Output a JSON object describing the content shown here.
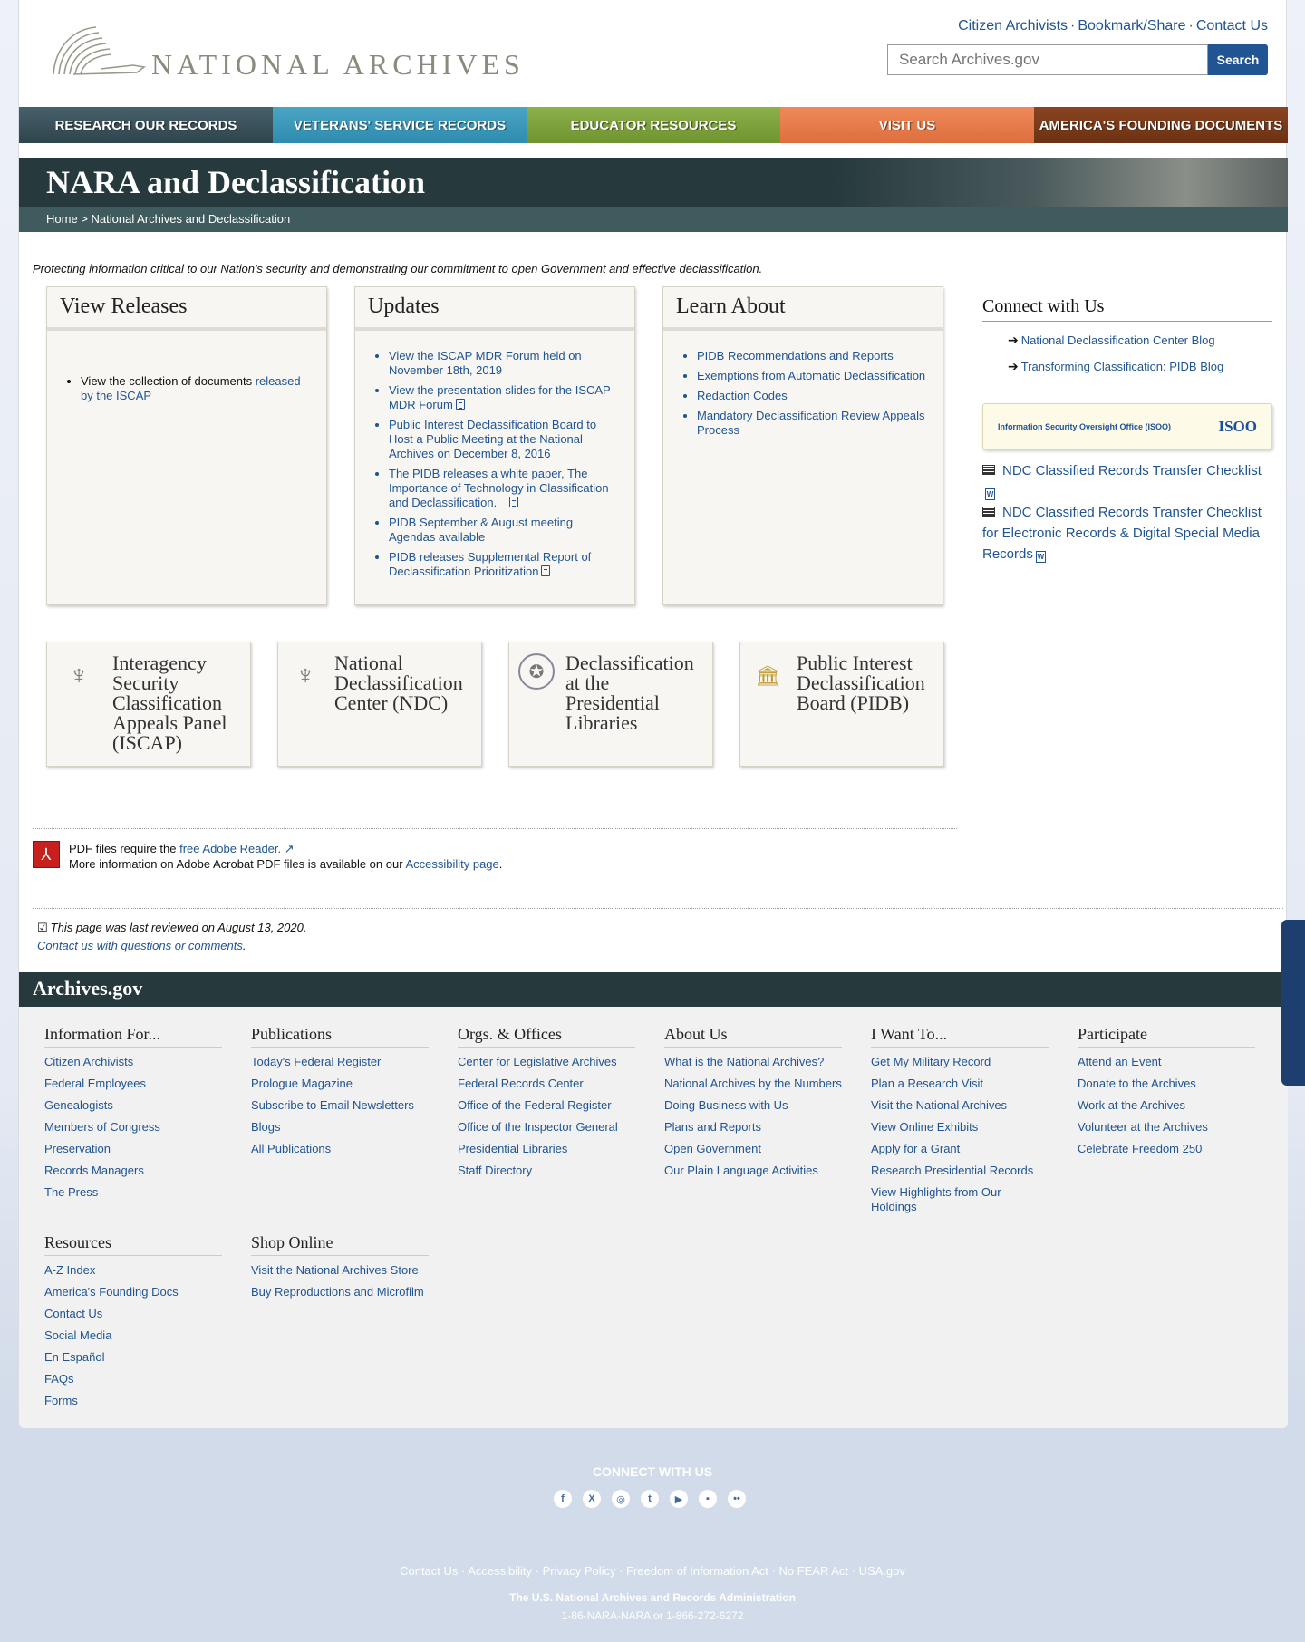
{
  "header": {
    "logo_text": "NATIONAL ARCHIVES",
    "utility_links": [
      "Citizen Archivists",
      "Bookmark/Share",
      "Contact Us"
    ],
    "search": {
      "placeholder": "Search Archives.gov",
      "button": "Search"
    }
  },
  "nav": [
    "RESEARCH OUR RECORDS",
    "VETERANS' SERVICE RECORDS",
    "EDUCATOR RESOURCES",
    "VISIT US",
    "AMERICA'S FOUNDING DOCUMENTS"
  ],
  "banner": {
    "title": "NARA and Declassification",
    "breadcrumb": {
      "home": "Home",
      "separator": ">",
      "current": "National Archives and Declassification"
    }
  },
  "tagline": "Protecting information critical to our Nation's security and demonstrating our commitment to open Government and effective declassification.",
  "view_releases": {
    "title": "View Releases",
    "text": "View the collection of documents ",
    "link": "released by the ISCAP"
  },
  "updates": {
    "title": "Updates",
    "items": [
      "View the ISCAP MDR Forum held on November 18th, 2019",
      "View the presentation slides for the ISCAP MDR Forum",
      "Public Interest Declassification Board to Host a Public Meeting at the National Archives on December 8, 2016",
      "The PIDB releases a white paper, The Importance of Technology in Classification and Declassification.",
      "PIDB September & August meeting Agendas available",
      "PIDB releases Supplemental Report of Declassification Prioritization"
    ]
  },
  "learn_about": {
    "title": "Learn About",
    "items": [
      "PIDB Recommendations and Reports",
      "Exemptions from Automatic Declassification",
      "Redaction Codes",
      "Mandatory Declassification Review Appeals Process"
    ]
  },
  "connect": {
    "title": "Connect with Us",
    "blogs": [
      "National Declassification Center Blog",
      "Transforming Classification: PIDB Blog"
    ],
    "isoo_name": "Information Security Oversight Office (ISOO)",
    "isoo_logo": "ISOO",
    "checklists": [
      "NDC Classified Records Transfer Checklist",
      "NDC Classified Records Transfer Checklist for Electronic Records & Digital Special Media Records"
    ]
  },
  "cards": [
    "Interagency Security Classification Appeals Panel (ISCAP)",
    "National Declassification Center (NDC)",
    "Declassification at the Presidential Libraries",
    "Public Interest Declassification Board (PIDB)"
  ],
  "pdf_note": {
    "line1_text": "PDF files require the ",
    "line1_link": "free Adobe Reader.",
    "line2_text": "More information on Adobe Acrobat PDF files is available on our ",
    "line2_link": "Accessibility page",
    "line2_end": "."
  },
  "review": {
    "reviewed": "This page was last reviewed on August 13, 2020.",
    "contact_link": "Contact us with questions or comments",
    "contact_end": "."
  },
  "footer": {
    "brand": "Archives.gov",
    "columns": [
      {
        "title": "Information For...",
        "links": [
          "Citizen Archivists",
          "Federal Employees",
          "Genealogists",
          "Members of Congress",
          "Preservation",
          "Records Managers",
          "The Press"
        ]
      },
      {
        "title": "Publications",
        "links": [
          "Today's Federal Register",
          "Prologue Magazine",
          "Subscribe to Email Newsletters",
          "Blogs",
          "All Publications"
        ]
      },
      {
        "title": "Orgs. & Offices",
        "links": [
          "Center for Legislative Archives",
          "Federal Records Center",
          "Office of the Federal Register",
          "Office of the Inspector General",
          "Presidential Libraries",
          "Staff Directory"
        ]
      },
      {
        "title": "About Us",
        "links": [
          "What is the National Archives?",
          "National Archives by the Numbers",
          "Doing Business with Us",
          "Plans and Reports",
          "Open Government",
          "Our Plain Language Activities"
        ]
      },
      {
        "title": "I Want To...",
        "links": [
          "Get My Military Record",
          "Plan a Research Visit",
          "Visit the National Archives",
          "View Online Exhibits",
          "Apply for a Grant",
          "Research Presidential Records",
          "View Highlights from Our Holdings"
        ]
      },
      {
        "title": "Participate",
        "links": [
          "Attend an Event",
          "Donate to the Archives",
          "Work at the Archives",
          "Volunteer at the Archives",
          "Celebrate Freedom 250"
        ]
      },
      {
        "title": "Resources",
        "links": [
          "A-Z Index",
          "America's Founding Docs",
          "Contact Us",
          "Social Media",
          "En Español",
          "FAQs",
          "Forms"
        ]
      },
      {
        "title": "Shop Online",
        "links": [
          "Visit the National Archives Store",
          "Buy Reproductions and Microfilm"
        ]
      }
    ]
  },
  "bottom": {
    "connect_title": "CONNECT WITH US",
    "socials": [
      {
        "name": "facebook-icon",
        "glyph": "f"
      },
      {
        "name": "x-icon",
        "glyph": "X"
      },
      {
        "name": "instagram-icon",
        "glyph": "◎"
      },
      {
        "name": "tumblr-icon",
        "glyph": "t"
      },
      {
        "name": "youtube-icon",
        "glyph": "▶"
      },
      {
        "name": "blog-icon",
        "glyph": "▪"
      },
      {
        "name": "flickr-icon",
        "glyph": "••"
      }
    ],
    "links": [
      "Contact Us",
      "Accessibility",
      "Privacy Policy",
      "Freedom of Information Act",
      "No FEAR Act",
      "USA.gov"
    ],
    "org": "The U.S. National Archives and Records Administration",
    "phone": "1-86-NARA-NARA or 1-866-272-6272"
  }
}
